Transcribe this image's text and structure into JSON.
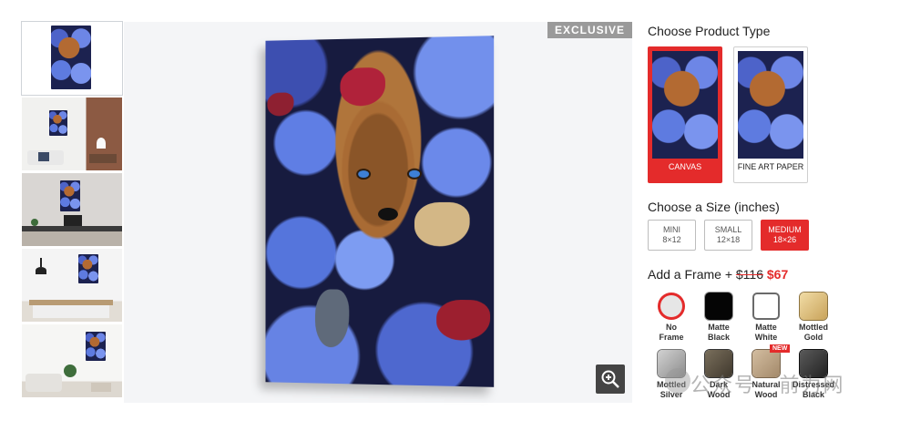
{
  "badge": "EXCLUSIVE",
  "product_type": {
    "heading": "Choose Product Type",
    "options": [
      {
        "label": "CANVAS",
        "selected": true
      },
      {
        "label": "FINE ART PAPER",
        "selected": false
      }
    ]
  },
  "size": {
    "heading": "Choose a Size (inches)",
    "options": [
      {
        "name": "MINI",
        "dims": "8×12",
        "selected": false
      },
      {
        "name": "SMALL",
        "dims": "12×18",
        "selected": false
      },
      {
        "name": "MEDIUM",
        "dims": "18×26",
        "selected": true
      }
    ]
  },
  "frame": {
    "heading_prefix": "Add a Frame +",
    "old_price": "$116",
    "new_price": "$67",
    "new_tag": "NEW",
    "options": [
      {
        "line1": "No",
        "line2": "Frame",
        "color": "#e6e6e6",
        "selected": true
      },
      {
        "line1": "Matte",
        "line2": "Black",
        "color": "#050505",
        "selected": false
      },
      {
        "line1": "Matte",
        "line2": "White",
        "color": "#ffffff",
        "selected": false
      },
      {
        "line1": "Mottled",
        "line2": "Gold",
        "color": "#e3c787",
        "selected": false
      },
      {
        "line1": "Mottled",
        "line2": "Silver",
        "color": "#a9a9a9",
        "selected": false
      },
      {
        "line1": "Dark",
        "line2": "Wood",
        "color": "#5b5243",
        "selected": false
      },
      {
        "line1": "Natural",
        "line2": "Wood",
        "color": "#b8a184",
        "selected": false
      },
      {
        "line1": "Distressed",
        "line2": "Black",
        "color": "#3c3c3c",
        "selected": false
      }
    ]
  },
  "watermark": "公众号 · 前为网",
  "colors": {
    "accent": "#e42b2b",
    "viewer_bg": "#f4f5f7",
    "badge_bg": "#9a9a9a"
  },
  "icons": {
    "zoom": "zoom-in-icon"
  }
}
